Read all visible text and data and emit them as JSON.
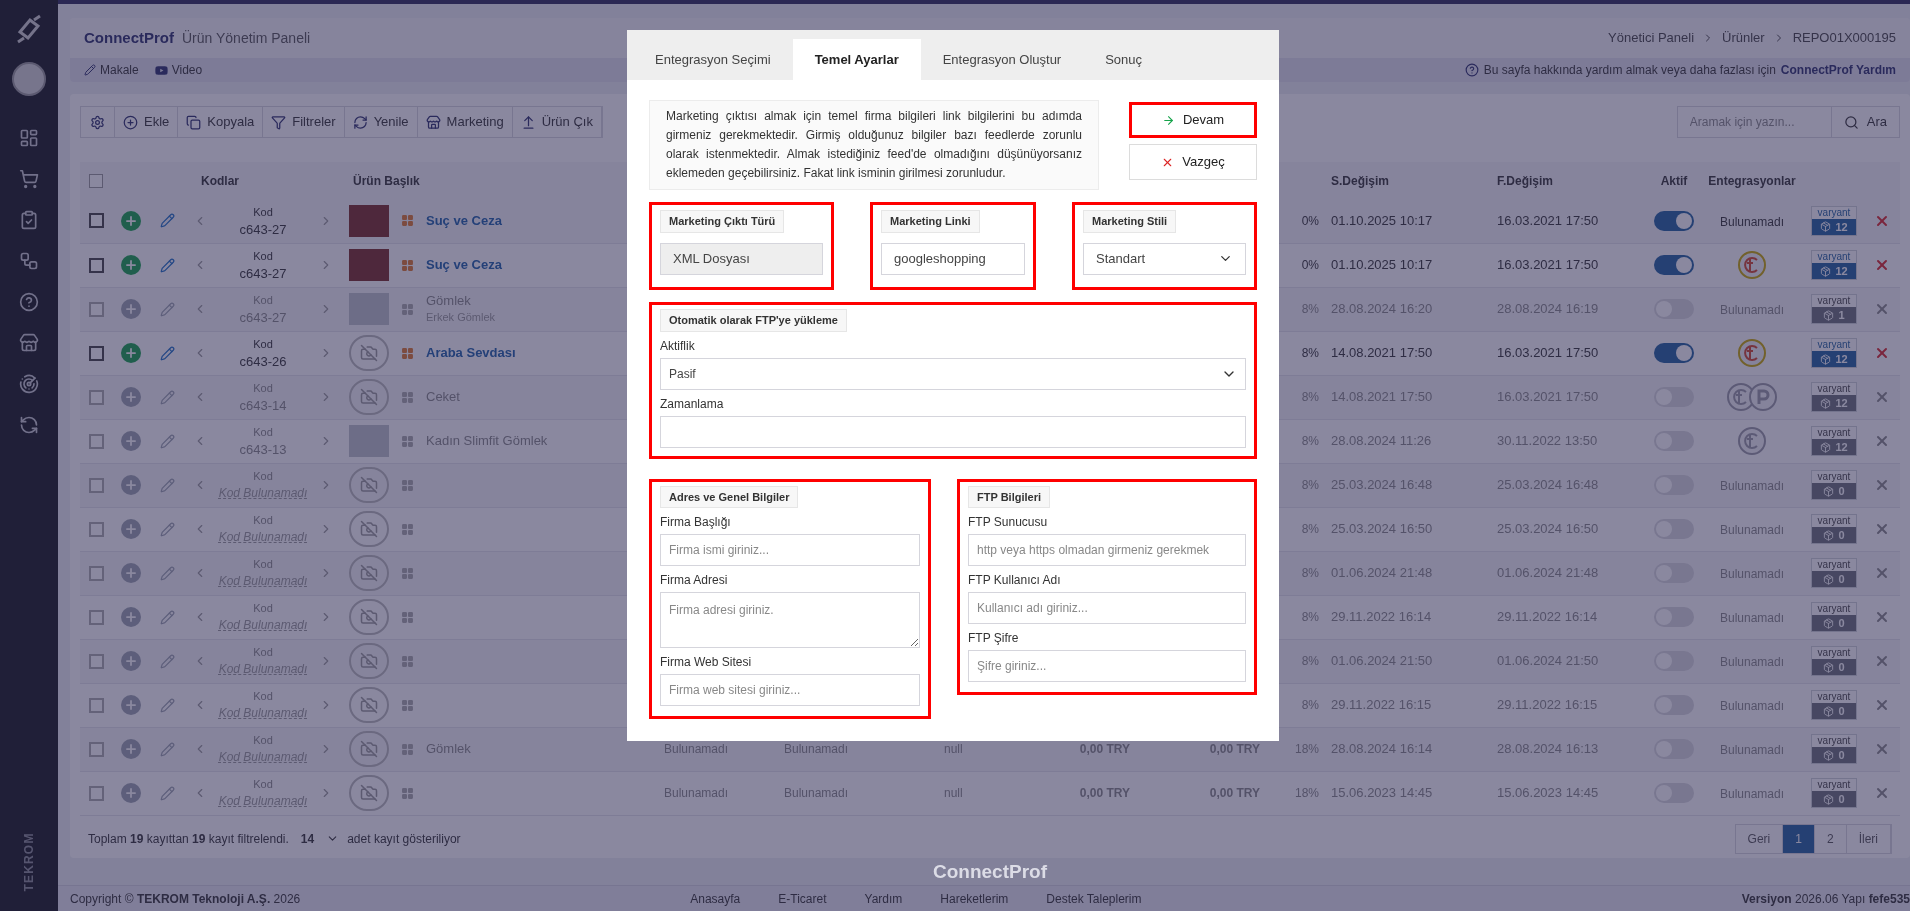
{
  "sidebar": {
    "footer_text": "TEKROM"
  },
  "header": {
    "brand": "ConnectProf",
    "title": "Ürün Yönetim Paneli",
    "breadcrumb": [
      "Yönetici Paneli",
      "Ürünler",
      "REPO01X000195"
    ]
  },
  "subbar": {
    "links": [
      {
        "kind": "article",
        "label": "Makale"
      },
      {
        "kind": "video",
        "label": "Video"
      }
    ],
    "help_text": "Bu sayfa hakkında yardım almak veya daha fazlası için",
    "help_link": "ConnectProf Yardım"
  },
  "toolbar": {
    "buttons": [
      {
        "kind": "add",
        "label": "Ekle"
      },
      {
        "kind": "copy",
        "label": "Kopyala"
      },
      {
        "kind": "filter",
        "label": "Filtreler"
      },
      {
        "kind": "refresh",
        "label": "Yenile"
      },
      {
        "kind": "store",
        "label": "Marketing"
      },
      {
        "kind": "export",
        "label": "Ürün Çık"
      }
    ],
    "search_placeholder": "Aramak için yazın...",
    "search_button": "Ara"
  },
  "table": {
    "select_all_checked": false,
    "columns": {
      "codes": "Kodlar",
      "title": "Ürün Başlık",
      "s_change": "S.Değişim",
      "f_change": "F.Değişim",
      "active": "Aktif",
      "integrations": "Entegrasyonlar"
    },
    "rows": [
      {
        "checked": false,
        "active": true,
        "code": {
          "kind": "value",
          "label": "Kod",
          "text": "c643-27"
        },
        "image": {
          "kind": "photo"
        },
        "title": "Suç ve Ceza",
        "cells": [],
        "percent": "0%",
        "s_change": "01.10.2025 10:17",
        "f_change": "16.03.2021 17:50",
        "integrations": {
          "kind": "text",
          "text": "Bulunamadı"
        },
        "variant_label": "varyant",
        "variant_count": "12"
      },
      {
        "checked": false,
        "active": true,
        "code": {
          "kind": "value",
          "label": "Kod",
          "text": "c643-27"
        },
        "image": {
          "kind": "photo"
        },
        "title": "Suç ve Ceza",
        "cells": [],
        "percent": "0%",
        "s_change": "01.10.2025 10:17",
        "f_change": "16.03.2021 17:50",
        "integrations": {
          "kind": "logos",
          "logos": [
            {
              "kind": "t"
            }
          ]
        },
        "variant_label": "varyant",
        "variant_count": "12"
      },
      {
        "checked": false,
        "active": false,
        "code": {
          "kind": "value",
          "label": "Kod",
          "text": "c643-27"
        },
        "image": {
          "kind": "photo"
        },
        "title": "Gömlek",
        "subtitle": "Erkek Gömlek",
        "cells": [],
        "percent": "8%",
        "s_change": "28.08.2024 16:20",
        "f_change": "28.08.2024 16:19",
        "integrations": {
          "kind": "text",
          "text": "Bulunamadı"
        },
        "variant_label": "varyant",
        "variant_count": "1"
      },
      {
        "checked": false,
        "active": true,
        "code": {
          "kind": "value",
          "label": "Kod",
          "text": "c643-26"
        },
        "image": {
          "kind": "none"
        },
        "title": "Araba Sevdası",
        "cells": [],
        "percent": "8%",
        "s_change": "14.08.2021 17:50",
        "f_change": "16.03.2021 17:50",
        "integrations": {
          "kind": "logos",
          "logos": [
            {
              "kind": "t"
            }
          ]
        },
        "variant_label": "varyant",
        "variant_count": "12"
      },
      {
        "checked": false,
        "active": false,
        "code": {
          "kind": "value",
          "label": "Kod",
          "text": "c643-14"
        },
        "image": {
          "kind": "none"
        },
        "title": "Ceket",
        "cells": [],
        "percent": "8%",
        "s_change": "14.08.2021 17:50",
        "f_change": "16.03.2021 17:50",
        "integrations": {
          "kind": "logos",
          "logos": [
            {
              "kind": "t"
            },
            {
              "kind": "p"
            }
          ]
        },
        "variant_label": "varyant",
        "variant_count": "12"
      },
      {
        "checked": false,
        "active": false,
        "code": {
          "kind": "value",
          "label": "Kod",
          "text": "c643-13"
        },
        "image": {
          "kind": "photo"
        },
        "title": "Kadın Slimfit Gömlek",
        "cells": [],
        "percent": "8%",
        "s_change": "28.08.2024 11:26",
        "f_change": "30.11.2022 13:50",
        "integrations": {
          "kind": "logos",
          "logos": [
            {
              "kind": "t"
            }
          ]
        },
        "variant_label": "varyant",
        "variant_count": "12"
      },
      {
        "checked": false,
        "active": false,
        "code": {
          "kind": "missing",
          "label": "Kod",
          "text": "Kod Bulunamadı"
        },
        "image": {
          "kind": "none"
        },
        "cells": [],
        "percent": "8%",
        "s_change": "25.03.2024 16:48",
        "f_change": "25.03.2024 16:48",
        "integrations": {
          "kind": "text",
          "text": "Bulunamadı"
        },
        "variant_label": "varyant",
        "variant_count": "0"
      },
      {
        "checked": false,
        "active": false,
        "code": {
          "kind": "missing",
          "label": "Kod",
          "text": "Kod Bulunamadı"
        },
        "image": {
          "kind": "none"
        },
        "cells": [],
        "percent": "8%",
        "s_change": "25.03.2024 16:50",
        "f_change": "25.03.2024 16:50",
        "integrations": {
          "kind": "text",
          "text": "Bulunamadı"
        },
        "variant_label": "varyant",
        "variant_count": "0"
      },
      {
        "checked": false,
        "active": false,
        "code": {
          "kind": "missing",
          "label": "Kod",
          "text": "Kod Bulunamadı"
        },
        "image": {
          "kind": "none"
        },
        "cells": [],
        "percent": "8%",
        "s_change": "01.06.2024 21:48",
        "f_change": "01.06.2024 21:48",
        "integrations": {
          "kind": "text",
          "text": "Bulunamadı"
        },
        "variant_label": "varyant",
        "variant_count": "0"
      },
      {
        "checked": false,
        "active": false,
        "code": {
          "kind": "missing",
          "label": "Kod",
          "text": "Kod Bulunamadı"
        },
        "image": {
          "kind": "none"
        },
        "cells": [],
        "percent": "8%",
        "s_change": "29.11.2022 16:14",
        "f_change": "29.11.2022 16:14",
        "integrations": {
          "kind": "text",
          "text": "Bulunamadı"
        },
        "variant_label": "varyant",
        "variant_count": "0"
      },
      {
        "checked": false,
        "active": false,
        "code": {
          "kind": "missing",
          "label": "Kod",
          "text": "Kod Bulunamadı"
        },
        "image": {
          "kind": "none"
        },
        "cells": [],
        "percent": "8%",
        "s_change": "01.06.2024 21:50",
        "f_change": "01.06.2024 21:50",
        "integrations": {
          "kind": "text",
          "text": "Bulunamadı"
        },
        "variant_label": "varyant",
        "variant_count": "0"
      },
      {
        "checked": false,
        "active": false,
        "code": {
          "kind": "missing",
          "label": "Kod",
          "text": "Kod Bulunamadı"
        },
        "image": {
          "kind": "none"
        },
        "cells": [],
        "percent": "8%",
        "s_change": "29.11.2022 16:15",
        "f_change": "29.11.2022 16:15",
        "integrations": {
          "kind": "text",
          "text": "Bulunamadı"
        },
        "variant_label": "varyant",
        "variant_count": "0"
      },
      {
        "checked": false,
        "active": false,
        "code": {
          "kind": "missing",
          "label": "Kod",
          "text": "Kod Bulunamadı"
        },
        "image": {
          "kind": "none"
        },
        "title": "Gömlek",
        "cells": [
          "Bulunamadı",
          "Bulunamadı",
          "null",
          "0,00 TRY",
          "0,00 TRY"
        ],
        "percent": "18%",
        "s_change": "28.08.2024 16:14",
        "f_change": "28.08.2024 16:13",
        "integrations": {
          "kind": "text",
          "text": "Bulunamadı"
        },
        "variant_label": "varyant",
        "variant_count": "0"
      },
      {
        "checked": false,
        "active": false,
        "code": {
          "kind": "missing",
          "label": "Kod",
          "text": "Kod Bulunamadı"
        },
        "image": {
          "kind": "none"
        },
        "cells": [
          "Bulunamadı",
          "Bulunamadı",
          "null",
          "0,00 TRY",
          "0,00 TRY"
        ],
        "percent": "18%",
        "s_change": "15.06.2023 14:45",
        "f_change": "15.06.2023 14:45",
        "integrations": {
          "kind": "text",
          "text": "Bulunamadı"
        },
        "variant_label": "varyant",
        "variant_count": "0"
      }
    ],
    "summary": "Toplam **19** kayıttan **19** kayıt filtrelendi.",
    "page_size": "14",
    "summary_suffix": "adet kayıt gösteriliyor",
    "pagination": [
      {
        "label": "Geri",
        "selected": false
      },
      {
        "label": "1",
        "selected": true
      },
      {
        "label": "2",
        "selected": false
      },
      {
        "label": "İleri",
        "selected": false
      }
    ]
  },
  "footer": {
    "brand": "ConnectProf",
    "copyright": "Copyright © **TEKROM Teknoloji A.Ş.** 2026",
    "links": [
      "Anasayfa",
      "E-Ticaret",
      "Yardım",
      "Hareketlerim",
      "Destek Taleplerim"
    ],
    "version": "**Versiyon** 2026.06 Yapı **fefe535**"
  },
  "modal": {
    "tabs": [
      {
        "label": "Entegrasyon Seçimi",
        "selected": false
      },
      {
        "label": "Temel Ayarlar",
        "selected": true
      },
      {
        "label": "Entegrasyon Oluştur",
        "selected": false
      },
      {
        "label": "Sonuç",
        "selected": false
      }
    ],
    "info": "Marketing çıktısı almak için temel firma bilgileri link bilgilerini bu adımda girmeniz gerekmektedir. Girmiş olduğunuz bilgiler bazı feedlerde zorunlu olarak istenmektedir. Almak istediğiniz feed'de olmadığını düşünüyorsanız eklemeden geçebilirsiniz. Fakat link isminin girilmesi zorunludur.",
    "buttons": [
      {
        "kind": "continue",
        "label": "Devam",
        "highlighted": true
      },
      {
        "kind": "cancel",
        "label": "Vazgeç",
        "highlighted": false
      }
    ],
    "top_fields": [
      {
        "legend": "Marketing Çıktı Türü",
        "kind": "readonly",
        "value": "XML Dosyası",
        "highlighted": true
      },
      {
        "legend": "Marketing Linki",
        "kind": "input",
        "value": "googleshopping",
        "highlighted": true
      },
      {
        "legend": "Marketing Stili",
        "kind": "select",
        "value": "Standart",
        "highlighted": true
      }
    ],
    "ftp_upload": {
      "legend": "Otomatik olarak FTP'ye yükleme",
      "highlighted": true,
      "fields": [
        {
          "label": "Aktiflik",
          "kind": "select",
          "value": "Pasif"
        },
        {
          "label": "Zamanlama",
          "kind": "input"
        }
      ]
    },
    "address": {
      "legend": "Adres ve Genel Bilgiler",
      "highlighted": true,
      "fields": [
        {
          "label": "Firma Başlığı",
          "kind": "input",
          "placeholder": "Firma ismi giriniz..."
        },
        {
          "label": "Firma Adresi",
          "kind": "textarea",
          "placeholder": "Firma adresi giriniz."
        },
        {
          "label": "Firma Web Sitesi",
          "kind": "input",
          "placeholder": "Firma web sitesi giriniz..."
        }
      ]
    },
    "ftp_info": {
      "legend": "FTP Bilgileri",
      "highlighted": true,
      "fields": [
        {
          "label": "FTP Sunucusu",
          "kind": "input",
          "placeholder": "http veya https olmadan girmeniz gerekmek"
        },
        {
          "label": "FTP Kullanıcı Adı",
          "kind": "input",
          "placeholder": "Kullanıcı adı giriniz..."
        },
        {
          "label": "FTP Şifre",
          "kind": "input",
          "placeholder": "Şifre giriniz..."
        }
      ]
    }
  }
}
